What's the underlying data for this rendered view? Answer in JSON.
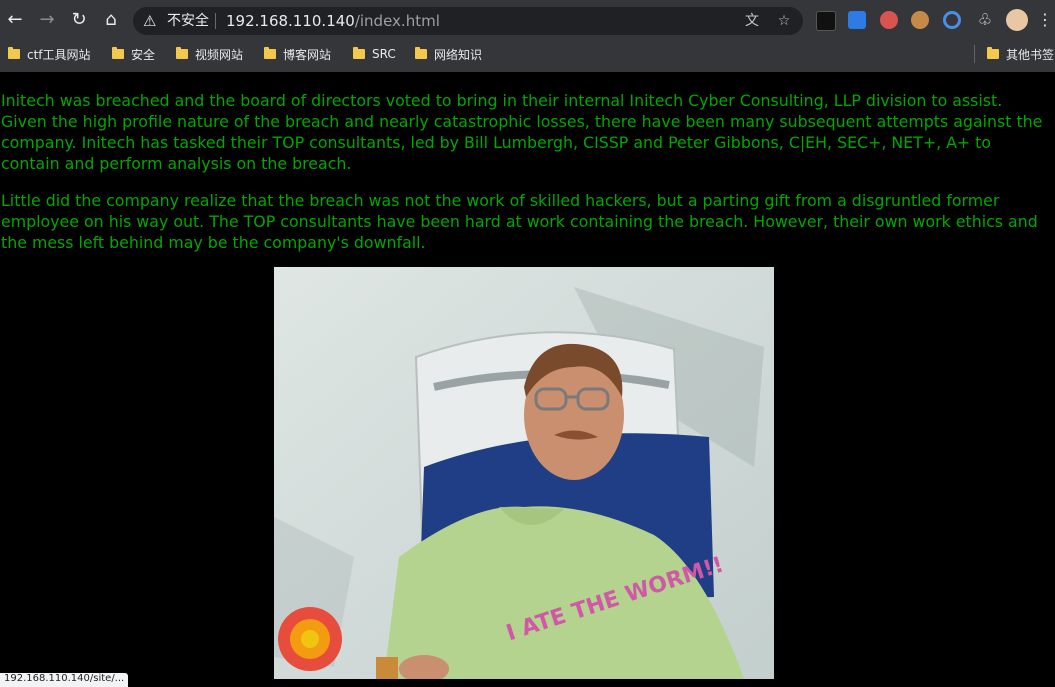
{
  "browser": {
    "insecure_label": "不安全",
    "url_host": "192.168.110.140",
    "url_path": "/index.html",
    "bookmarks": [
      "ctf工具网站",
      "安全",
      "视频网站",
      "博客网站",
      "SRC",
      "网络知识"
    ],
    "other_bookmarks": "其他书签",
    "status_text": "192.168.110.140/site/... "
  },
  "page": {
    "paragraph_1": "Initech was breached and the board of directors voted to bring in their internal Initech Cyber Consulting, LLP division to assist. Given the high profile nature of the breach and nearly catastrophic losses, there have been many subsequent attempts against the company. Initech has tasked their TOP consultants, led by Bill Lumbergh, CISSP and Peter Gibbons, C|EH, SEC+, NET+, A+ to contain and perform analysis on the breach.",
    "paragraph_2": "Little did the company realize that the breach was not the work of skilled hackers, but a parting gift from a disgruntled former employee on his way out. The TOP consultants have been hard at work containing the breach. However, their own work ethics and the mess left behind may be the company's downfall.",
    "shirt_text": "I ATE THE WORM!!",
    "text_color": "#00a800"
  }
}
